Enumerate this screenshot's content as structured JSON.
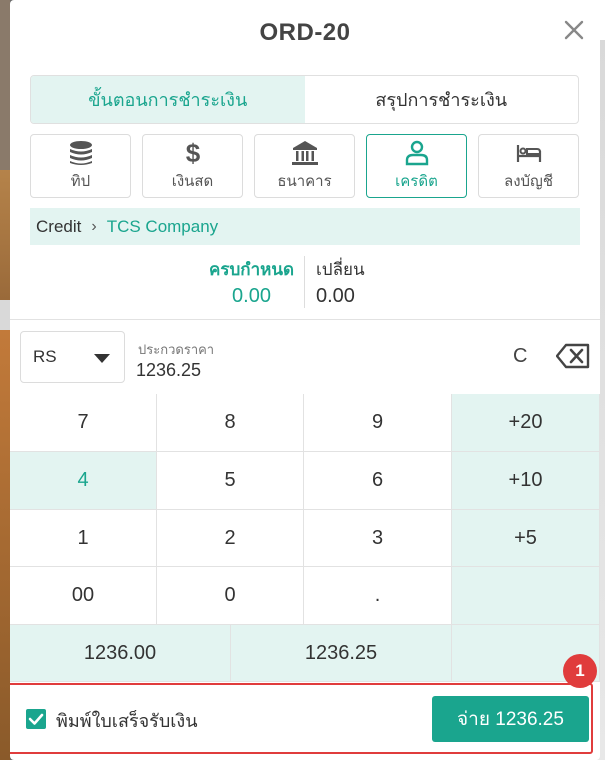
{
  "order": {
    "title": "ORD-20"
  },
  "tabs": [
    {
      "label": "ขั้นตอนการชำระเงิน",
      "active": true
    },
    {
      "label": "สรุปการชำระเงิน",
      "active": false
    }
  ],
  "methods": [
    {
      "label": "ทิป",
      "icon": "coins-icon",
      "active": false
    },
    {
      "label": "เงินสด",
      "icon": "dollar-icon",
      "active": false
    },
    {
      "label": "ธนาคาร",
      "icon": "bank-icon",
      "active": false
    },
    {
      "label": "เครดิต",
      "icon": "user-icon",
      "active": true
    },
    {
      "label": "ลงบัญชี",
      "icon": "bed-icon",
      "active": false
    }
  ],
  "breadcrumb": {
    "root": "Credit",
    "separator": "›",
    "company": "TCS Company"
  },
  "totals": {
    "due_label": "ครบกำหนด",
    "due_value": "0.00",
    "change_label": "เปลี่ยน",
    "change_value": "0.00"
  },
  "entry": {
    "currency": "RS",
    "amount_label": "ประกวดราคา",
    "amount": "1236.25",
    "clear": "C"
  },
  "keypad": {
    "rows": [
      [
        "7",
        "8",
        "9",
        "+20"
      ],
      [
        "4",
        "5",
        "6",
        "+10"
      ],
      [
        "1",
        "2",
        "3",
        "+5"
      ],
      [
        "00",
        "0",
        ".",
        ""
      ]
    ],
    "highlighted_key": "4",
    "quick_amounts": [
      "1236.00",
      "1236.25"
    ]
  },
  "footer": {
    "print_label": "พิมพ์ใบเสร็จรับเงิน",
    "print_checked": true,
    "pay_label": "จ่าย 1236.25"
  },
  "annotation": {
    "badge": "1"
  },
  "colors": {
    "accent": "#1aa58e",
    "accent_light": "#e3f4f1",
    "annotation": "#e03c3c"
  }
}
